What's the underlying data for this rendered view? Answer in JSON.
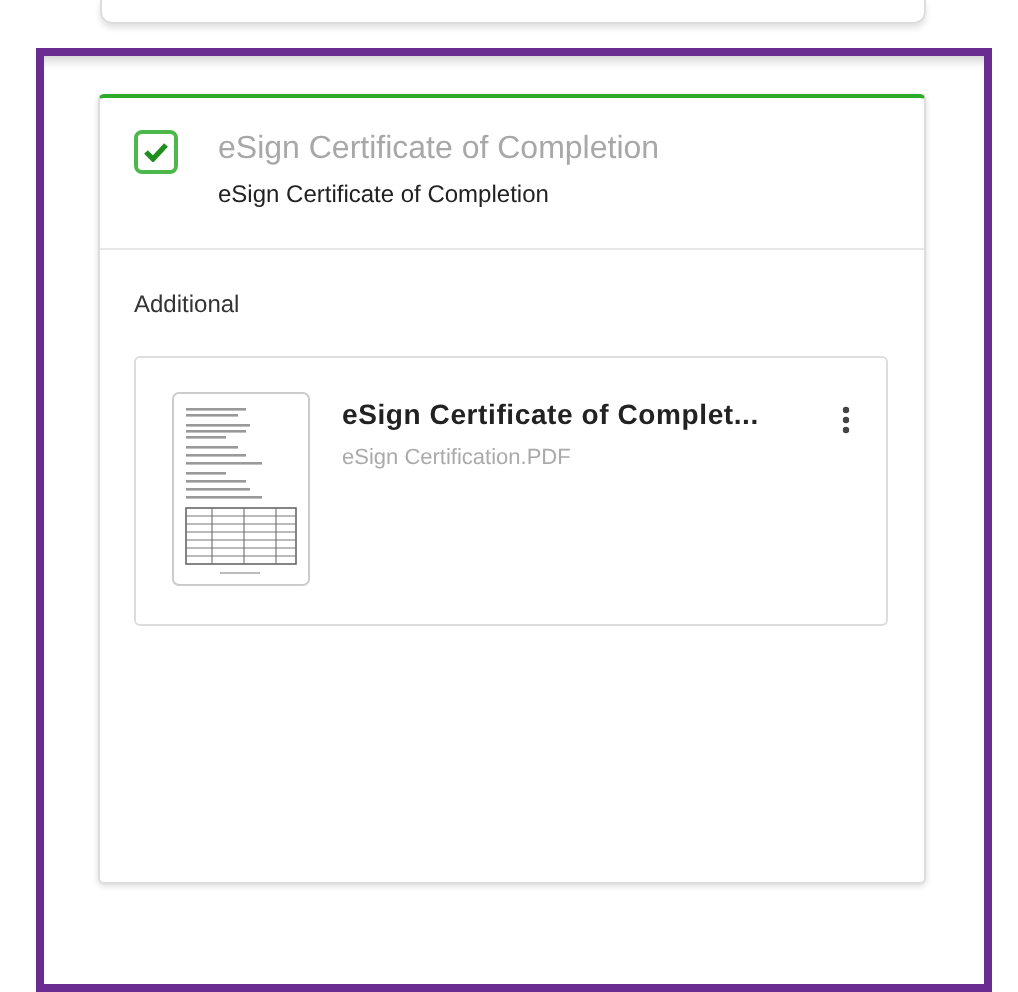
{
  "card": {
    "checked": true,
    "title": "eSign Certificate of Completion",
    "subtitle": "eSign Certificate of Completion"
  },
  "section": {
    "label": "Additional"
  },
  "files": [
    {
      "title": "eSign Certificate of Complet...",
      "filename": "eSign Certification.PDF"
    }
  ]
}
